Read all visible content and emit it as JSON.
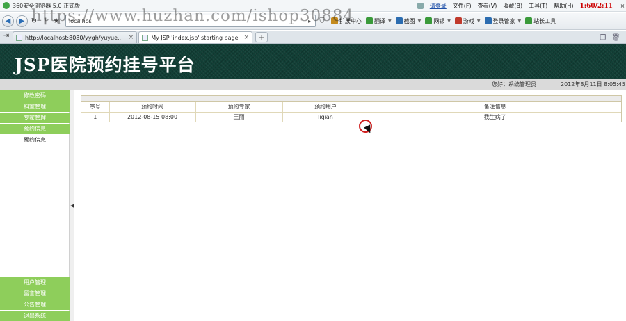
{
  "browser": {
    "title": "360安全浏览器 5.0 正式版",
    "menu": [
      "文件(F)",
      "查看(V)",
      "收藏(B)",
      "工具(T)",
      "帮助(H)"
    ],
    "login_link": "请登录",
    "clock": "1:60/2:11",
    "close": "×",
    "address": "localhos",
    "tools": [
      {
        "icon": "extensions-icon",
        "label": "扩展中心",
        "color": "#c48a1c"
      },
      {
        "icon": "translate-icon",
        "label": "翻译",
        "color": "#3a9a3a"
      },
      {
        "icon": "screenshot-icon",
        "label": "截图",
        "color": "#2b6cb0"
      },
      {
        "icon": "netbank-icon",
        "label": "网银",
        "color": "#3a9a3a"
      },
      {
        "icon": "games-icon",
        "label": "游戏",
        "color": "#c0392b"
      },
      {
        "icon": "login-manager-icon",
        "label": "登录管家",
        "color": "#2b6cb0"
      },
      {
        "icon": "webmaster-tools-icon",
        "label": "站长工具",
        "color": "#3a9a3a"
      }
    ],
    "tabs": [
      {
        "label": "http://localhost:8080/yygh/yuyue..."
      },
      {
        "label": "My JSP 'index.jsp' starting page"
      }
    ],
    "new_tab": "+"
  },
  "watermark": "https://www.huzhan.com/ishop30884",
  "header": {
    "title": "JSP医院预约挂号平台"
  },
  "infobar": {
    "greeting": "您好：系统管理员",
    "datetime": "2012年8月11日   8:05:45"
  },
  "sidebar": {
    "top_items": [
      "修改密码",
      "科室管理",
      "专家管理",
      "预约信息"
    ],
    "sub_item": "预约信息",
    "bottom_items": [
      "用户管理",
      "留言管理",
      "公告管理",
      "退出系统"
    ]
  },
  "table": {
    "headers": [
      "序号",
      "预约时间",
      "预约专家",
      "预约用户",
      "备注信息"
    ],
    "rows": [
      [
        "1",
        "2012-08-15 08:00",
        "王丽",
        "liqian",
        "我生病了"
      ]
    ]
  },
  "colors": {
    "header_bg": "#123f36",
    "menu_green": "#8ece5b",
    "click_ring": "#d02020"
  }
}
